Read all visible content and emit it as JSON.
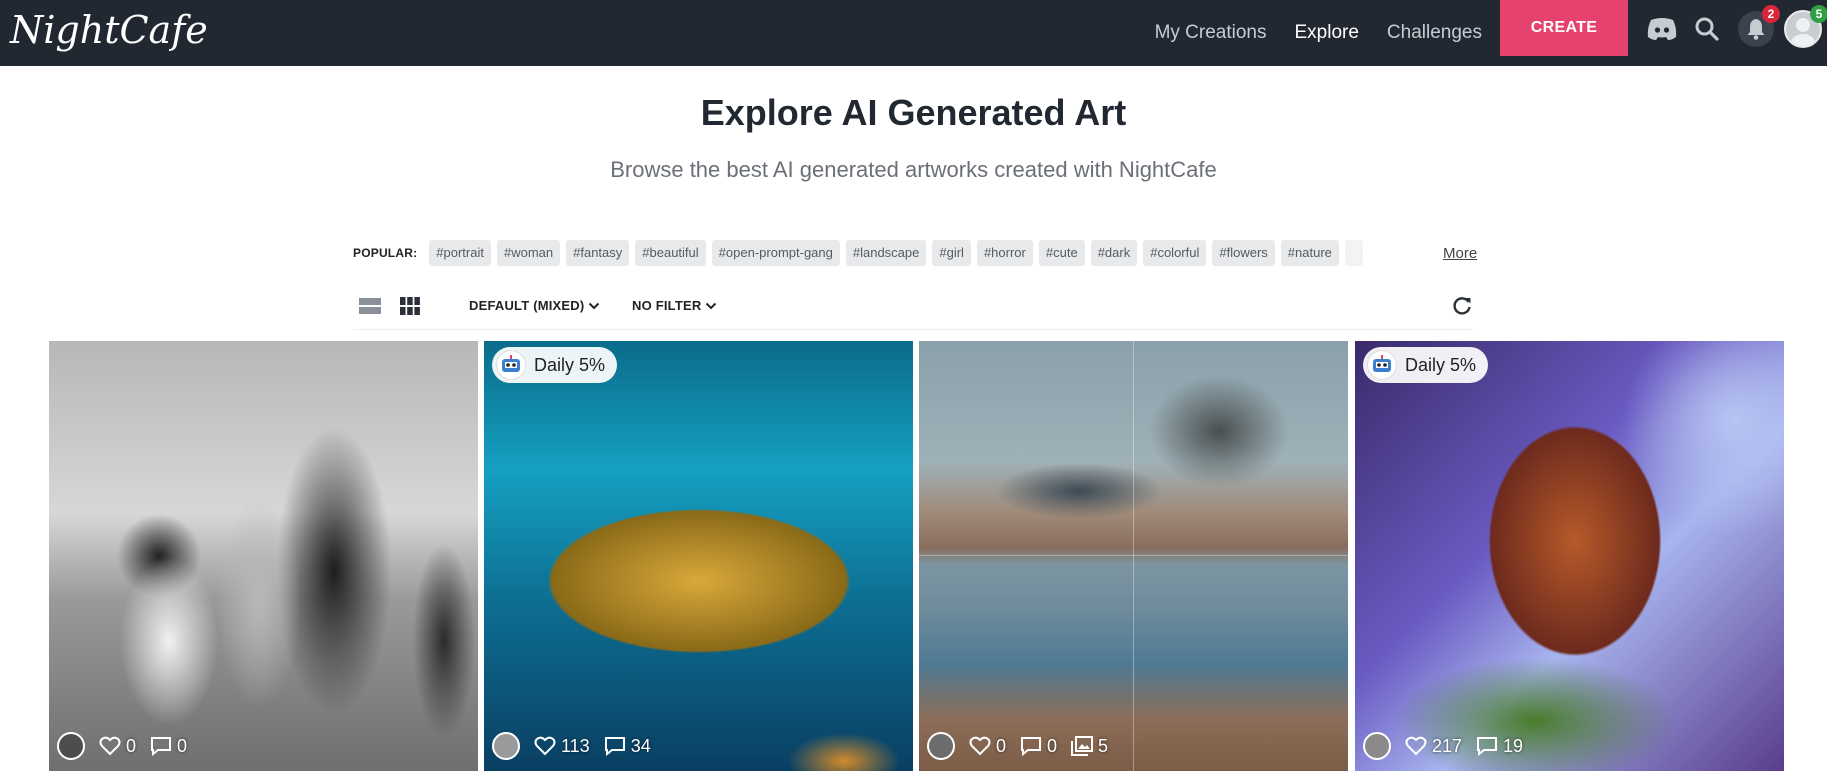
{
  "brand": {
    "logo_text": "NightCafe"
  },
  "nav": {
    "items": [
      {
        "label": "My Creations",
        "active": false
      },
      {
        "label": "Explore",
        "active": true
      },
      {
        "label": "Challenges",
        "active": false
      }
    ],
    "create_label": "CREATE",
    "notifications_count": "2",
    "profile_count": "5",
    "icons": [
      "discord-icon",
      "search-icon",
      "bell-icon",
      "profile-avatar"
    ]
  },
  "header": {
    "title": "Explore AI Generated Art",
    "subtitle": "Browse the best AI generated artworks created with NightCafe"
  },
  "tags": {
    "label": "POPULAR:",
    "items": [
      "#portrait",
      "#woman",
      "#fantasy",
      "#beautiful",
      "#open-prompt-gang",
      "#landscape",
      "#girl",
      "#horror",
      "#cute",
      "#dark",
      "#colorful",
      "#flowers",
      "#nature"
    ],
    "more_label": "More"
  },
  "toolbar": {
    "sort_label": "DEFAULT (MIXED)",
    "filter_label": "NO FILTER"
  },
  "cards": [
    {
      "daily": "",
      "likes": "0",
      "comments": "0",
      "images": ""
    },
    {
      "daily": "Daily 5%",
      "likes": "113",
      "comments": "34",
      "images": ""
    },
    {
      "daily": "",
      "likes": "0",
      "comments": "0",
      "images": "5"
    },
    {
      "daily": "Daily 5%",
      "likes": "217",
      "comments": "19",
      "images": ""
    }
  ],
  "colors": {
    "nav_bg": "#222831",
    "create_bg": "#e5426d",
    "badge_red": "#d9263a",
    "badge_green": "#2f9e44"
  }
}
